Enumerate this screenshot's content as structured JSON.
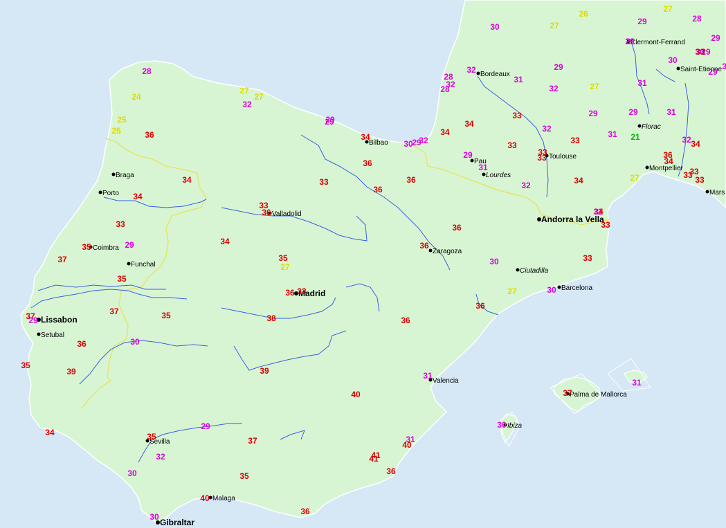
{
  "colors": {
    "sea": "#d6e7f6",
    "land": "#d7f5d3",
    "river": "#3a5fe0",
    "border": "#e5e56a",
    "coast": "#ffffff",
    "hot": "#dd0000",
    "warm": "#dd00dd",
    "mild": "#dddd00",
    "cool": "#00bb00"
  },
  "cities": [
    {
      "name": "Clermont-Ferrand",
      "style": "normal"
    },
    {
      "name": "Saint-Etienne",
      "style": "normal"
    },
    {
      "name": "Bordeaux",
      "style": "normal"
    },
    {
      "name": "Florac",
      "style": "italic"
    },
    {
      "name": "Bilbao",
      "style": "normal"
    },
    {
      "name": "Pau",
      "style": "normal"
    },
    {
      "name": "Toulouse",
      "style": "normal"
    },
    {
      "name": "Lourdes",
      "style": "italic"
    },
    {
      "name": "Montpellier",
      "style": "normal"
    },
    {
      "name": "Mars",
      "style": "normal"
    },
    {
      "name": "Braga",
      "style": "normal"
    },
    {
      "name": "Porto",
      "style": "normal"
    },
    {
      "name": "Valladolid",
      "style": "normal"
    },
    {
      "name": "Andorra la Vella",
      "style": "bold"
    },
    {
      "name": "Coimbra",
      "style": "normal"
    },
    {
      "name": "Zaragoza",
      "style": "normal"
    },
    {
      "name": "Funchal",
      "style": "normal"
    },
    {
      "name": "Ciutadilla",
      "style": "italic"
    },
    {
      "name": "Barcelona",
      "style": "normal"
    },
    {
      "name": "Madrid",
      "style": "bold"
    },
    {
      "name": "Lissabon",
      "style": "bold"
    },
    {
      "name": "Setubal",
      "style": "normal"
    },
    {
      "name": "Valencia",
      "style": "normal"
    },
    {
      "name": "Palma de Mallorca",
      "style": "normal"
    },
    {
      "name": "Ibiza",
      "style": "italic"
    },
    {
      "name": "Sevilla",
      "style": "normal"
    },
    {
      "name": "Malaga",
      "style": "normal"
    },
    {
      "name": "Gibraltar",
      "style": "bold"
    }
  ],
  "temperatures": [
    {
      "v": "30",
      "c": "warm"
    },
    {
      "v": "27",
      "c": "mild"
    },
    {
      "v": "26",
      "c": "mild"
    },
    {
      "v": "27",
      "c": "mild"
    },
    {
      "v": "28",
      "c": "warm"
    },
    {
      "v": "29",
      "c": "warm"
    },
    {
      "v": "29",
      "c": "warm"
    },
    {
      "v": "29",
      "c": "warm"
    },
    {
      "v": "30",
      "c": "warm"
    },
    {
      "v": "29",
      "c": "warm"
    },
    {
      "v": "30",
      "c": "warm"
    },
    {
      "v": "29",
      "c": "warm"
    },
    {
      "v": "28",
      "c": "warm"
    },
    {
      "v": "32",
      "c": "warm"
    },
    {
      "v": "31",
      "c": "warm"
    },
    {
      "v": "28",
      "c": "warm"
    },
    {
      "v": "32",
      "c": "warm"
    },
    {
      "v": "29",
      "c": "warm"
    },
    {
      "v": "32",
      "c": "warm"
    },
    {
      "v": "31",
      "c": "warm"
    },
    {
      "v": "27",
      "c": "mild"
    },
    {
      "v": "28",
      "c": "warm"
    },
    {
      "v": "27",
      "c": "mild"
    },
    {
      "v": "27",
      "c": "mild"
    },
    {
      "v": "32",
      "c": "warm"
    },
    {
      "v": "24",
      "c": "mild"
    },
    {
      "v": "31",
      "c": "warm"
    },
    {
      "v": "31",
      "c": "warm"
    },
    {
      "v": "33",
      "c": "hot"
    },
    {
      "v": "29",
      "c": "warm"
    },
    {
      "v": "29",
      "c": "warm"
    },
    {
      "v": "25",
      "c": "mild"
    },
    {
      "v": "25",
      "c": "mild"
    },
    {
      "v": "29",
      "c": "warm"
    },
    {
      "v": "29",
      "c": "warm"
    },
    {
      "v": "34",
      "c": "hot"
    },
    {
      "v": "34",
      "c": "hot"
    },
    {
      "v": "32",
      "c": "warm"
    },
    {
      "v": "36",
      "c": "hot"
    },
    {
      "v": "33",
      "c": "hot"
    },
    {
      "v": "31",
      "c": "warm"
    },
    {
      "v": "21",
      "c": "cool"
    },
    {
      "v": "31",
      "c": "warm"
    },
    {
      "v": "34",
      "c": "hot"
    },
    {
      "v": "30",
      "c": "warm"
    },
    {
      "v": "29",
      "c": "warm"
    },
    {
      "v": "32",
      "c": "warm"
    },
    {
      "v": "33",
      "c": "hot"
    },
    {
      "v": "33",
      "c": "hot"
    },
    {
      "v": "34",
      "c": "hot"
    },
    {
      "v": "36",
      "c": "hot"
    },
    {
      "v": "32",
      "c": "warm"
    },
    {
      "v": "33",
      "c": "hot"
    },
    {
      "v": "34",
      "c": "hot"
    },
    {
      "v": "36",
      "c": "hot"
    },
    {
      "v": "29",
      "c": "warm"
    },
    {
      "v": "34",
      "c": "hot"
    },
    {
      "v": "34",
      "c": "hot"
    },
    {
      "v": "33",
      "c": "hot"
    },
    {
      "v": "31",
      "c": "warm"
    },
    {
      "v": "33",
      "c": "hot"
    },
    {
      "v": "33",
      "c": "hot"
    },
    {
      "v": "27",
      "c": "mild"
    },
    {
      "v": "36",
      "c": "hot"
    },
    {
      "v": "33",
      "c": "hot"
    },
    {
      "v": "32",
      "c": "warm"
    },
    {
      "v": "36",
      "c": "hot"
    },
    {
      "v": "33",
      "c": "hot"
    },
    {
      "v": "34",
      "c": "hot"
    },
    {
      "v": "34",
      "c": "hot"
    },
    {
      "v": "33",
      "c": "hot"
    },
    {
      "v": "36",
      "c": "hot"
    },
    {
      "v": "36",
      "c": "hot"
    },
    {
      "v": "32",
      "c": "warm"
    },
    {
      "v": "33",
      "c": "hot"
    },
    {
      "v": "33",
      "c": "hot"
    },
    {
      "v": "35",
      "c": "hot"
    },
    {
      "v": "27",
      "c": "mild"
    },
    {
      "v": "33",
      "c": "hot"
    },
    {
      "v": "35",
      "c": "hot"
    },
    {
      "v": "34",
      "c": "hot"
    },
    {
      "v": "29",
      "c": "warm"
    },
    {
      "v": "36",
      "c": "hot"
    },
    {
      "v": "37",
      "c": "hot"
    },
    {
      "v": "30",
      "c": "warm"
    },
    {
      "v": "35",
      "c": "hot"
    },
    {
      "v": "27",
      "c": "mild"
    },
    {
      "v": "36",
      "c": "hot"
    },
    {
      "v": "33",
      "c": "hot"
    },
    {
      "v": "37",
      "c": "hot"
    },
    {
      "v": "29",
      "c": "warm"
    },
    {
      "v": "30",
      "c": "warm"
    },
    {
      "v": "36",
      "c": "hot"
    },
    {
      "v": "36",
      "c": "hot"
    },
    {
      "v": "35",
      "c": "hot"
    },
    {
      "v": "37",
      "c": "hot"
    },
    {
      "v": "38",
      "c": "hot"
    },
    {
      "v": "36",
      "c": "hot"
    },
    {
      "v": "30",
      "c": "warm"
    },
    {
      "v": "35",
      "c": "hot"
    },
    {
      "v": "39",
      "c": "hot"
    },
    {
      "v": "39",
      "c": "hot"
    },
    {
      "v": "31",
      "c": "warm"
    },
    {
      "v": "40",
      "c": "hot"
    },
    {
      "v": "37",
      "c": "hot"
    },
    {
      "v": "31",
      "c": "warm"
    },
    {
      "v": "30",
      "c": "warm"
    },
    {
      "v": "34",
      "c": "hot"
    },
    {
      "v": "29",
      "c": "warm"
    },
    {
      "v": "31",
      "c": "warm"
    },
    {
      "v": "35",
      "c": "hot"
    },
    {
      "v": "40",
      "c": "hot"
    },
    {
      "v": "41",
      "c": "hot"
    },
    {
      "v": "37",
      "c": "hot"
    },
    {
      "v": "32",
      "c": "warm"
    },
    {
      "v": "41",
      "c": "hot"
    },
    {
      "v": "30",
      "c": "warm"
    },
    {
      "v": "35",
      "c": "hot"
    },
    {
      "v": "36",
      "c": "hot"
    },
    {
      "v": "40",
      "c": "hot"
    },
    {
      "v": "36",
      "c": "hot"
    },
    {
      "v": "30",
      "c": "warm"
    },
    {
      "v": "30",
      "c": "warm"
    },
    {
      "v": "37",
      "c": "hot"
    },
    {
      "v": "29",
      "c": "mild"
    }
  ]
}
